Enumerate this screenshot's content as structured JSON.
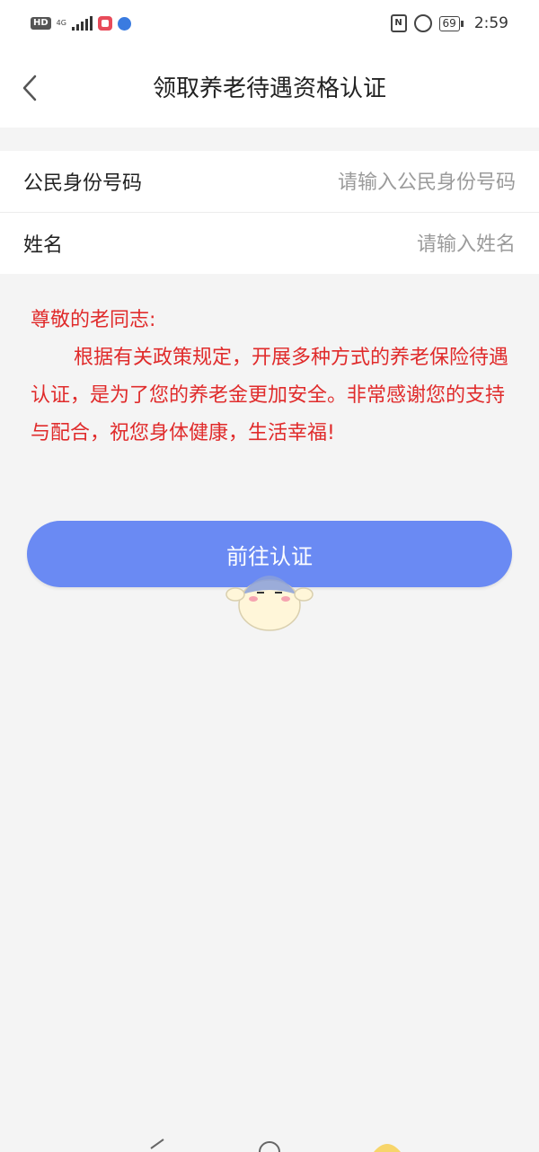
{
  "status_bar": {
    "left_icons": [
      "hd-icon",
      "4g-signal-icon",
      "app-notification-icon",
      "browser-icon"
    ],
    "hd_label": "HD",
    "network_label": "4G",
    "battery_level": "69",
    "time": "2:59"
  },
  "header": {
    "title": "领取养老待遇资格认证"
  },
  "form": {
    "id_number": {
      "label": "公民身份号码",
      "value": "",
      "placeholder": "请输入公民身份号码"
    },
    "name": {
      "label": "姓名",
      "value": "",
      "placeholder": "请输入姓名"
    }
  },
  "notice": {
    "title": "尊敬的老同志:",
    "body": "根据有关政策规定，开展多种方式的养老保险待遇认证，是为了您的养老金更加安全。非常感谢您的支持与配合，祝您身体健康，生活幸福!"
  },
  "actions": {
    "submit_label": "前往认证"
  },
  "colors": {
    "accent": "#6a8af3",
    "notice_text": "#e02b2b",
    "background": "#f4f4f4"
  }
}
